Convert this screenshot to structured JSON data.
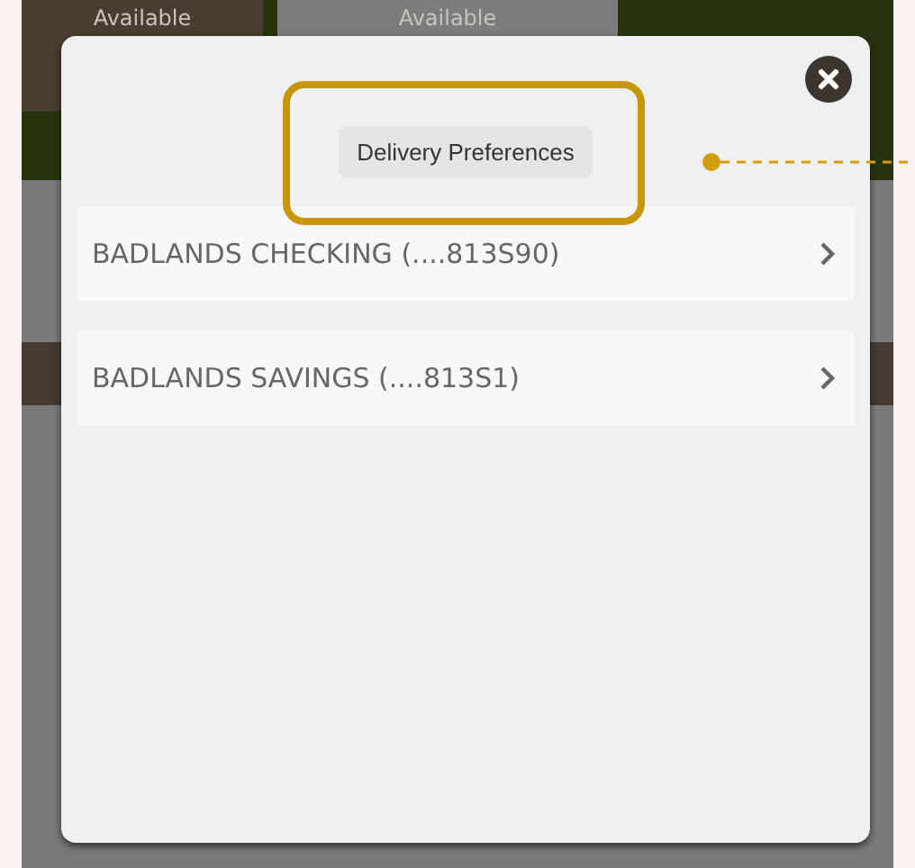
{
  "background": {
    "accounts": [
      {
        "label": "Available",
        "kind": "dark"
      },
      {
        "label": "Available",
        "kind": "light"
      }
    ]
  },
  "dialog": {
    "button": "Delivery Preferences",
    "highlighted": true,
    "accounts": [
      {
        "name": "BADLANDS CHECKING (....813S90)"
      },
      {
        "name": "BADLANDS SAVINGS (....813S1)"
      }
    ]
  }
}
